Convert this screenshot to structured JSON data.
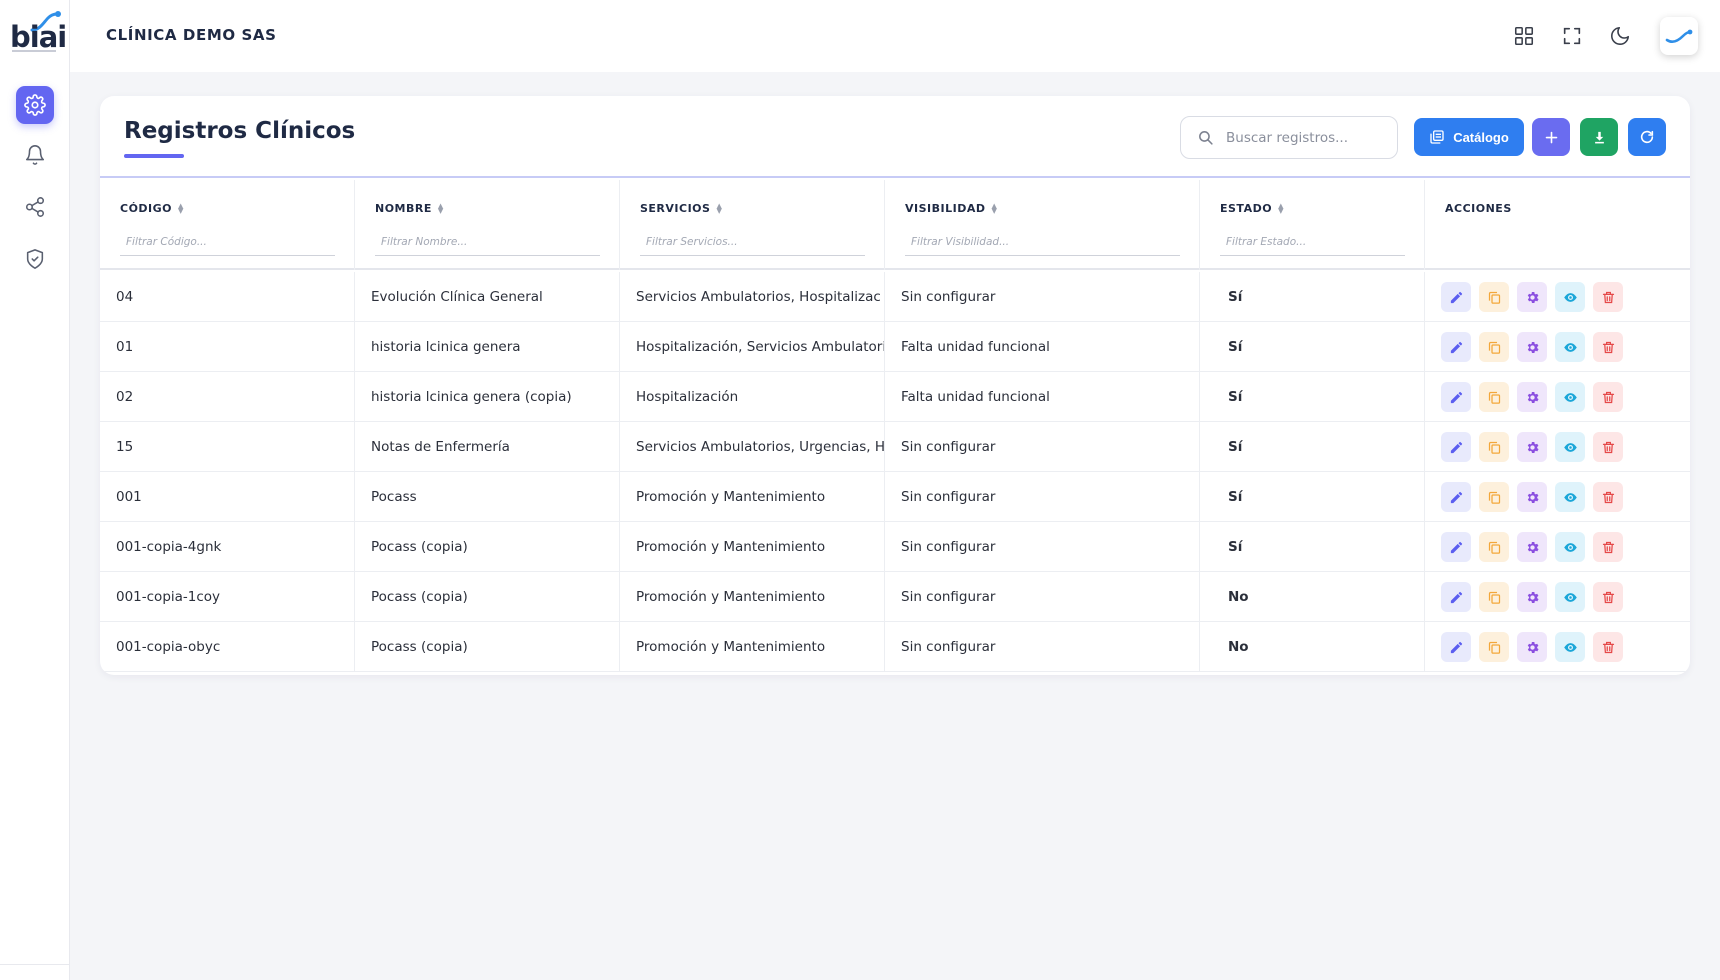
{
  "header": {
    "clinic_name": "CLÍNICA DEMO SAS",
    "logo_text": "biai"
  },
  "sidebar": {
    "items": [
      {
        "name": "settings",
        "icon": "gear-icon",
        "active": true
      },
      {
        "name": "notifications",
        "icon": "bell-icon",
        "active": false
      },
      {
        "name": "share",
        "icon": "share-icon",
        "active": false
      },
      {
        "name": "security",
        "icon": "shield-check-icon",
        "active": false
      }
    ]
  },
  "toolbar": {
    "title": "Registros Clínicos",
    "search_placeholder": "Buscar registros...",
    "catalog_label": "Catálogo"
  },
  "table": {
    "columns": [
      {
        "label": "CÓDIGO",
        "filter_placeholder": "Filtrar Código..."
      },
      {
        "label": "NOMBRE",
        "filter_placeholder": "Filtrar Nombre..."
      },
      {
        "label": "SERVICIOS",
        "filter_placeholder": "Filtrar Servicios..."
      },
      {
        "label": "VISIBILIDAD",
        "filter_placeholder": "Filtrar Visibilidad..."
      },
      {
        "label": "ESTADO",
        "filter_placeholder": "Filtrar Estado..."
      },
      {
        "label": "ACCIONES",
        "filter_placeholder": ""
      }
    ],
    "rows": [
      {
        "codigo": "04",
        "nombre": "Evolución Clínica General",
        "servicios": "Servicios Ambulatorios, Hospitalizac",
        "visibilidad": "Sin configurar",
        "estado": "Sí"
      },
      {
        "codigo": "01",
        "nombre": "historia lcinica genera",
        "servicios": "Hospitalización, Servicios Ambulatori",
        "visibilidad": "Falta unidad funcional",
        "estado": "Sí"
      },
      {
        "codigo": "02",
        "nombre": "historia lcinica genera (copia)",
        "servicios": "Hospitalización",
        "visibilidad": "Falta unidad funcional",
        "estado": "Sí"
      },
      {
        "codigo": "15",
        "nombre": "Notas de Enfermería",
        "servicios": "Servicios Ambulatorios, Urgencias, H",
        "visibilidad": "Sin configurar",
        "estado": "Sí"
      },
      {
        "codigo": "001",
        "nombre": "Pocass",
        "servicios": "Promoción y Mantenimiento",
        "visibilidad": "Sin configurar",
        "estado": "Sí"
      },
      {
        "codigo": "001-copia-4gnk",
        "nombre": "Pocass (copia)",
        "servicios": "Promoción y Mantenimiento",
        "visibilidad": "Sin configurar",
        "estado": "Sí"
      },
      {
        "codigo": "001-copia-1coy",
        "nombre": "Pocass (copia)",
        "servicios": "Promoción y Mantenimiento",
        "visibilidad": "Sin configurar",
        "estado": "No"
      },
      {
        "codigo": "001-copia-obyc",
        "nombre": "Pocass (copia)",
        "servicios": "Promoción y Mantenimiento",
        "visibilidad": "Sin configurar",
        "estado": "No"
      }
    ],
    "row_actions": [
      "edit-icon",
      "copy-icon",
      "gear-icon",
      "eye-icon",
      "trash-icon"
    ]
  },
  "colors": {
    "accent": "#6366f1",
    "primary_blue": "#2f7ef0",
    "success_green": "#1fa463",
    "edit": "#5b5ef0",
    "copy": "#f3a73a",
    "config": "#8b4fe0",
    "view": "#1ba6d8",
    "delete": "#e54848"
  }
}
